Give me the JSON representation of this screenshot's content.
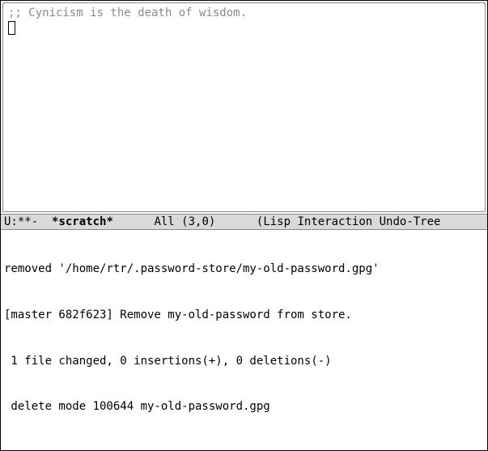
{
  "buffer": {
    "comment": ";; Cynicism is the death of wisdom."
  },
  "modeline": {
    "status": "U:**-  ",
    "buffer_name": "*scratch*",
    "gap1": "      ",
    "position": "All (3,0)",
    "gap2": "      ",
    "modes": "(Lisp Interaction Undo-Tree"
  },
  "echo": {
    "line1": "removed '/home/rtr/.password-store/my-old-password.gpg'",
    "line2": "[master 682f623] Remove my-old-password from store.",
    "line3": " 1 file changed, 0 insertions(+), 0 deletions(-)",
    "line4": " delete mode 100644 my-old-password.gpg"
  }
}
